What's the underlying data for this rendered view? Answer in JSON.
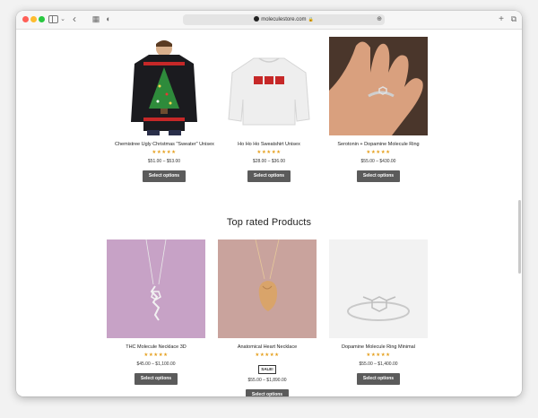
{
  "browser": {
    "url": "moleculestore.com",
    "icons": {
      "back": "chevron-left-icon",
      "forward_menu": "chevron-down-icon",
      "tab_overview": "grid-icon",
      "privacy": "shield-icon",
      "new_tab": "plus-icon",
      "tabs": "tabs-icon"
    },
    "glyphs": {
      "back": "‹",
      "chev": "⌄",
      "grid": "▦",
      "shield": "◐",
      "plus": "+",
      "tabs": "⧉",
      "lock": "🔒",
      "reader": "⊕"
    }
  },
  "products_top": [
    {
      "name": "Chemistree Ugly Christmas \"Sweater\" Unisex",
      "stars": "★★★★★",
      "price": "$51.00 – $53.00",
      "button": "Select options"
    },
    {
      "name": "Ho Ho Ho Sweatshirt Unisex",
      "stars": "★★★★★",
      "price": "$28.00 – $36.00",
      "button": "Select options"
    },
    {
      "name": "Serotonin + Dopamine Molecule Ring",
      "stars": "★★★★★",
      "price": "$55.00 – $430.00",
      "button": "Select options"
    }
  ],
  "section": {
    "title": "Top rated Products"
  },
  "products_rated": [
    {
      "name": "THC Molecule Necklace 3D",
      "stars": "★★★★★",
      "price": "$45.00 – $1,100.00",
      "button": "Select options"
    },
    {
      "name": "Anatomical Heart Necklace",
      "stars": "★★★★★",
      "sale": "SALE!",
      "price": "$55.00 – $1,890.00",
      "button": "Select options"
    },
    {
      "name": "Dopamine Molecule Ring Minimal",
      "stars": "★★★★★",
      "price": "$55.00 – $1,400.00",
      "button": "Select options"
    }
  ],
  "colors": {
    "button_bg": "#5b5b5b",
    "star": "#e6a121",
    "sweater_dark": "#1b1b1f",
    "tree_green": "#2e8b3b"
  }
}
